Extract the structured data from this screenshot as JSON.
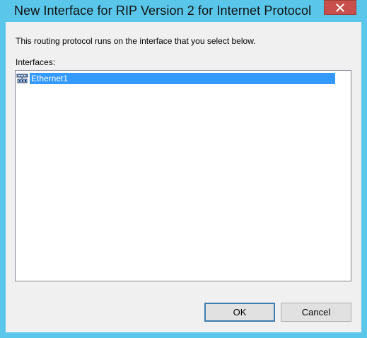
{
  "window": {
    "title": "New Interface for RIP Version 2 for Internet Protocol",
    "close_icon": "close-icon"
  },
  "content": {
    "description": "This routing protocol runs on the interface that you select below.",
    "interfaces_label": "Interfaces:",
    "interfaces": [
      {
        "label": "Ethernet1",
        "icon": "network-adapter-icon",
        "selected": true
      }
    ]
  },
  "buttons": {
    "ok_label": "OK",
    "cancel_label": "Cancel"
  },
  "colors": {
    "titlebar": "#5ac6ea",
    "close_button": "#c7504c",
    "selection": "#3399ff"
  }
}
